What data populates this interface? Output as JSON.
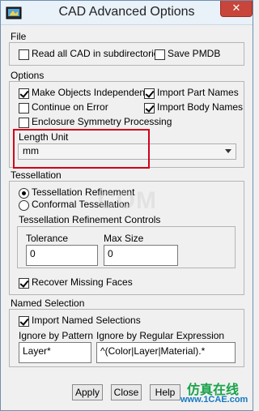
{
  "window": {
    "title": "CAD Advanced Options",
    "close_glyph": "✕",
    "accent_close": "#c7453a"
  },
  "file": {
    "label": "File",
    "read_all_cad": {
      "label": "Read all CAD in subdirectories",
      "checked": false
    },
    "save_pmdb": {
      "label": "Save PMDB",
      "checked": false
    }
  },
  "options": {
    "label": "Options",
    "make_objects_independent": {
      "label": "Make Objects Independent",
      "checked": true
    },
    "import_part_names": {
      "label": "Import Part Names",
      "checked": true
    },
    "continue_on_error": {
      "label": "Continue on Error",
      "checked": false
    },
    "import_body_names": {
      "label": "Import Body Names",
      "checked": true
    },
    "enclosure": {
      "label": "Enclosure  Symmetry Processing",
      "checked": false
    },
    "length_unit": {
      "label": "Length Unit",
      "value": "mm"
    }
  },
  "tessellation": {
    "label": "Tessellation",
    "refinement": {
      "label": "Tessellation Refinement",
      "selected": true
    },
    "conformal": {
      "label": "Conformal Tessellation",
      "selected": false
    },
    "controls_label": "Tessellation Refinement Controls",
    "tolerance": {
      "label": "Tolerance",
      "value": "0"
    },
    "max_size": {
      "label": "Max Size",
      "value": "0"
    },
    "recover_missing_faces": {
      "label": "Recover Missing Faces",
      "checked": true
    }
  },
  "named_selection": {
    "label": "Named Selection",
    "import_named_selections": {
      "label": "Import Named Selections",
      "checked": true
    },
    "ignore_by_pattern": {
      "label": "Ignore by Pattern",
      "value": "Layer*"
    },
    "ignore_by_regex": {
      "label": "Ignore by Regular Expression",
      "value": "^(Color|Layer|Material).*"
    }
  },
  "footer": {
    "apply": "Apply",
    "close": "Close",
    "help": "Help"
  },
  "watermark": {
    "com": "COM",
    "cn": "仿真在线",
    "url": "www.1CAE.com"
  }
}
